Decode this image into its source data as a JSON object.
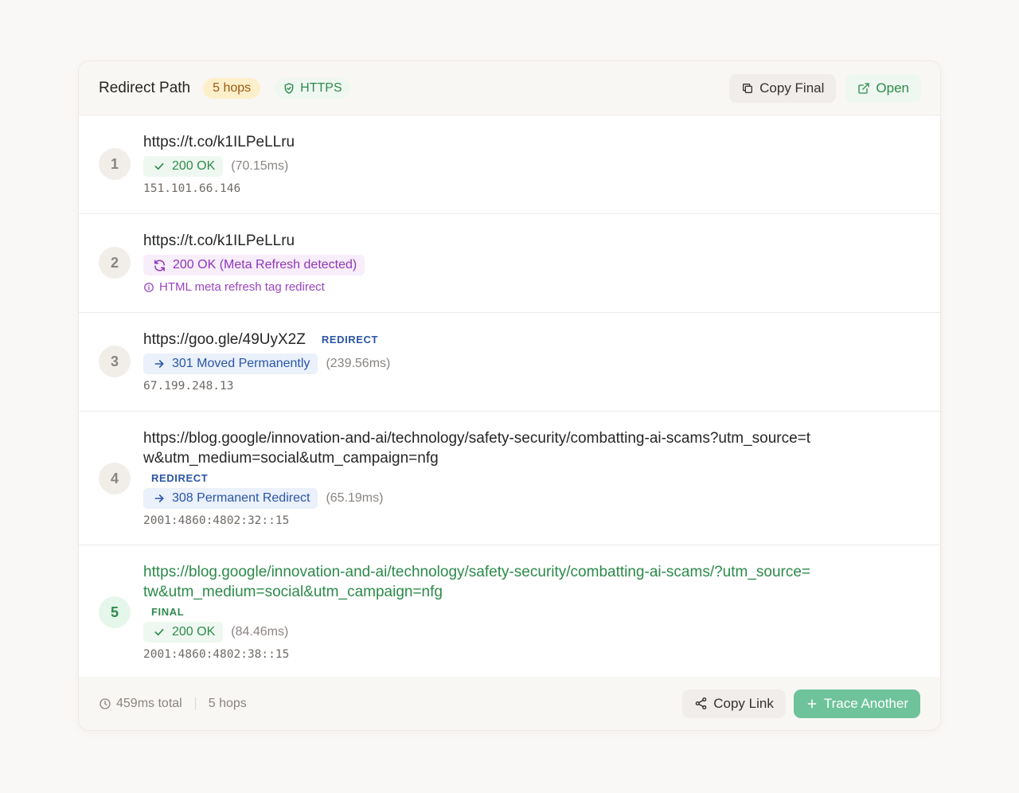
{
  "header": {
    "title": "Redirect Path",
    "hops_badge": "5 hops",
    "https_badge": "HTTPS",
    "copy_final_label": "Copy Final",
    "open_label": "Open"
  },
  "hops": [
    {
      "number": "1",
      "url": "https://t.co/k1ILPeLLru",
      "tag": "",
      "status": "200 OK",
      "timing": "(70.15ms)",
      "ip": "151.101.66.146"
    },
    {
      "number": "2",
      "url": "https://t.co/k1ILPeLLru",
      "status": "200 OK (Meta Refresh detected)",
      "note": "HTML meta refresh tag redirect"
    },
    {
      "number": "3",
      "url": "https://goo.gle/49UyX2Z",
      "tag": "REDIRECT",
      "status": "301 Moved Permanently",
      "timing": "(239.56ms)",
      "ip": "67.199.248.13"
    },
    {
      "number": "4",
      "url_line1": "https://blog.google/innovation-and-ai/technology/safety-security/combatting-ai-scams?utm_source=t",
      "url_line2": "w&utm_medium=social&utm_campaign=nfg",
      "tag": "REDIRECT",
      "status": "308 Permanent Redirect",
      "timing": "(65.19ms)",
      "ip": "2001:4860:4802:32::15"
    },
    {
      "number": "5",
      "url_line1": "https://blog.google/innovation-and-ai/technology/safety-security/combatting-ai-scams/?utm_source=",
      "url_line2": "tw&utm_medium=social&utm_campaign=nfg",
      "tag": "FINAL",
      "status": "200 OK",
      "timing": "(84.46ms)",
      "ip": "2001:4860:4802:38::15"
    }
  ],
  "footer": {
    "total_time": "459ms total",
    "hops": "5 hops",
    "copy_link_label": "Copy Link",
    "trace_another_label": "Trace Another"
  },
  "colors": {
    "accent_green": "#2f8a4d",
    "button_green": "#6ec39a",
    "redirect_blue": "#2b55a6",
    "meta_purple": "#9036b8",
    "hops_badge_bg": "#fdefc9"
  }
}
